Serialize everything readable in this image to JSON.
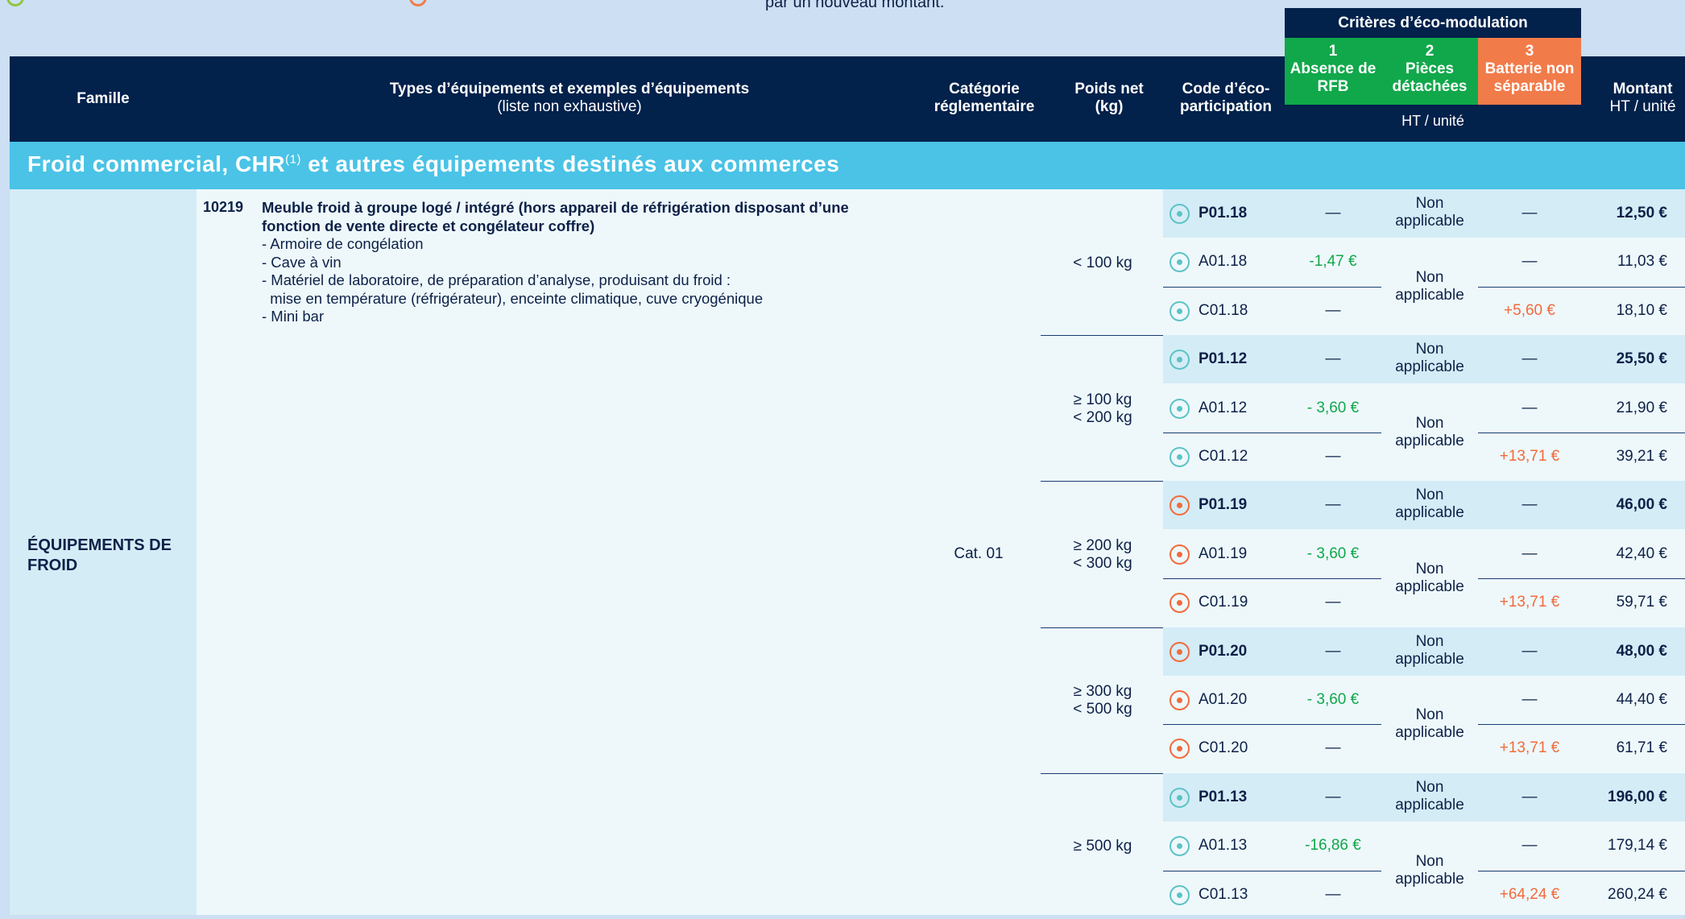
{
  "top_note": "par un nouveau montant.",
  "header": {
    "famille": "Famille",
    "types": "Types d’équipements et exemples d’équipements",
    "types_sub": "(liste non exhaustive)",
    "categorie": "Catégorie réglementaire",
    "poids": "Poids net",
    "poids_unit": "(kg)",
    "code": "Code d’éco-participation",
    "criteres_title": "Critères d’éco-modulation",
    "criteria": [
      {
        "num": "1",
        "label": "Absence de RFB"
      },
      {
        "num": "2",
        "label": "Pièces détachées"
      },
      {
        "num": "3",
        "label": "Batterie non séparable"
      }
    ],
    "criteria_unit": "HT / unité",
    "montant": "Montant",
    "montant_unit": "HT / unité"
  },
  "section": {
    "title": "Froid commercial, CHR",
    "sup": "(1)",
    "title_end": " et autres équipements destinés aux commerces"
  },
  "family": "ÉQUIPEMENTS DE FROID",
  "item": {
    "code": "10219",
    "title": "Meuble froid à groupe logé / intégré (hors appareil de réfrigération disposant d’une fonction de vente directe et congélateur coffre)",
    "lines": [
      "- Armoire de congélation",
      "- Cave à vin",
      "- Matériel de laboratoire, de préparation d’analyse, produisant du froid :",
      "  mise en température (réfrigérateur), enceinte climatique, cuve cryogénique",
      "- Mini bar"
    ]
  },
  "category": "Cat. 01",
  "not_applicable": "Non applicable",
  "dash": "—",
  "groups": [
    {
      "weight": "< 100 kg",
      "radio": "teal",
      "rows": [
        {
          "code": "P01.18",
          "c1": "—",
          "c3": "—",
          "amount": "12,50 €"
        },
        {
          "code": "A01.18",
          "c1": "-1,47 €",
          "c3": "—",
          "amount": "11,03 €"
        },
        {
          "code": "C01.18",
          "c1": "—",
          "c3": "+5,60 €",
          "amount": "18,10 €"
        }
      ]
    },
    {
      "weight": "≥ 100 kg\n< 200 kg",
      "radio": "teal",
      "rows": [
        {
          "code": "P01.12",
          "c1": "—",
          "c3": "—",
          "amount": "25,50 €"
        },
        {
          "code": "A01.12",
          "c1": "- 3,60 €",
          "c3": "—",
          "amount": "21,90 €"
        },
        {
          "code": "C01.12",
          "c1": "—",
          "c3": "+13,71 €",
          "amount": "39,21 €"
        }
      ]
    },
    {
      "weight": "≥ 200 kg\n< 300 kg",
      "radio": "orange",
      "rows": [
        {
          "code": "P01.19",
          "c1": "—",
          "c3": "—",
          "amount": "46,00 €"
        },
        {
          "code": "A01.19",
          "c1": "- 3,60 €",
          "c3": "—",
          "amount": "42,40 €"
        },
        {
          "code": "C01.19",
          "c1": "—",
          "c3": "+13,71 €",
          "amount": "59,71 €"
        }
      ]
    },
    {
      "weight": "≥ 300 kg\n< 500 kg",
      "radio": "orange",
      "rows": [
        {
          "code": "P01.20",
          "c1": "—",
          "c3": "—",
          "amount": "48,00 €"
        },
        {
          "code": "A01.20",
          "c1": "- 3,60 €",
          "c3": "—",
          "amount": "44,40 €"
        },
        {
          "code": "C01.20",
          "c1": "—",
          "c3": "+13,71 €",
          "amount": "61,71 €"
        }
      ]
    },
    {
      "weight": "≥ 500 kg",
      "radio": "teal",
      "rows": [
        {
          "code": "P01.13",
          "c1": "—",
          "c3": "—",
          "amount": "196,00 €"
        },
        {
          "code": "A01.13",
          "c1": "-16,86 €",
          "c3": "—",
          "amount": "179,14 €"
        },
        {
          "code": "C01.13",
          "c1": "—",
          "c3": "+64,24 €",
          "amount": "260,24 €"
        }
      ]
    }
  ],
  "colors": {
    "navy": "#02214b",
    "cyan": "#4ac3e6",
    "green": "#10a84a",
    "orange": "#f26a3b",
    "teal": "#5cc3c6"
  }
}
